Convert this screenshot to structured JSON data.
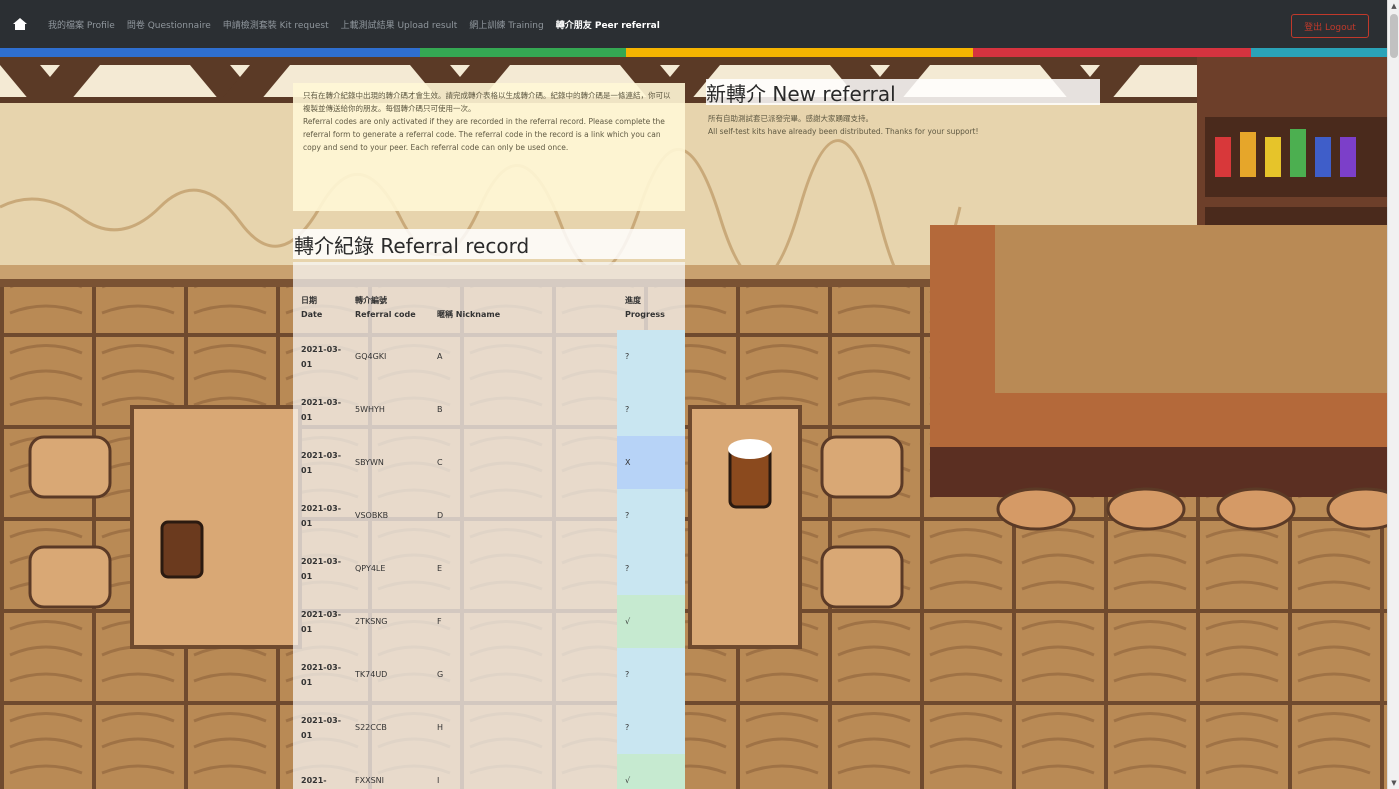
{
  "nav": {
    "items": [
      {
        "label": "我的檔案 Profile",
        "active": false
      },
      {
        "label": "問卷 Questionnaire",
        "active": false
      },
      {
        "label": "申請檢測套裝 Kit request",
        "active": false
      },
      {
        "label": "上載測試結果 Upload result",
        "active": false
      },
      {
        "label": "網上訓練 Training",
        "active": false
      },
      {
        "label": "轉介朋友 Peer referral",
        "active": true
      }
    ],
    "logout_label": "登出 Logout"
  },
  "notice": {
    "zh": "只有在轉介紀錄中出現的轉介碼才會生效。請完成轉介表格以生成轉介碼。紀錄中的轉介碼是一條連結，你可以複製並傳送給你的朋友。每個轉介碼只可使用一次。",
    "en": "Referral codes are only activated if they are recorded in the referral record. Please complete the referral form to generate a referral code. The referral code in the record is a link which you can copy and send to your peer. Each referral code can only be used once."
  },
  "record": {
    "title": "轉介紀錄 Referral record",
    "headers": {
      "date_zh": "日期",
      "date_en": "Date",
      "code_zh": "轉介編號",
      "code_en": "Referral code",
      "nick": "暱稱 Nickname",
      "progress_zh": "進度",
      "progress_en": "Progress"
    },
    "rows": [
      {
        "date": "2021-03-01",
        "code": "GQ4GKI",
        "nickname": "A",
        "progress": "?"
      },
      {
        "date": "2021-03-01",
        "code": "5WHYH",
        "nickname": "B",
        "progress": "?"
      },
      {
        "date": "2021-03-01",
        "code": "SBYWN",
        "nickname": "C",
        "progress": "X"
      },
      {
        "date": "2021-03-01",
        "code": "VSOBKB",
        "nickname": "D",
        "progress": "?"
      },
      {
        "date": "2021-03-01",
        "code": "QPY4LE",
        "nickname": "E",
        "progress": "?"
      },
      {
        "date": "2021-03-01",
        "code": "2TKSNG",
        "nickname": "F",
        "progress": "√"
      },
      {
        "date": "2021-03-01",
        "code": "TK74UD",
        "nickname": "G",
        "progress": "?"
      },
      {
        "date": "2021-03-01",
        "code": "S22CCB",
        "nickname": "H",
        "progress": "?"
      },
      {
        "date": "2021-",
        "code": "FXXSNI",
        "nickname": "I",
        "progress": "√"
      }
    ]
  },
  "new_referral": {
    "title": "新轉介 New referral",
    "zh": "所有自助測試套已派發完畢。感謝大家踴躍支持。",
    "en": "All self-test kits have already been distributed. Thanks for your support!"
  },
  "colors": {
    "strip": [
      "#2f6fd0",
      "#35a853",
      "#f6b400",
      "#d6333f",
      "#2aa3b8"
    ],
    "progress_unknown": "#c9e6f1",
    "progress_fail": "#b7d3f7",
    "progress_done": "#c6ead0"
  }
}
